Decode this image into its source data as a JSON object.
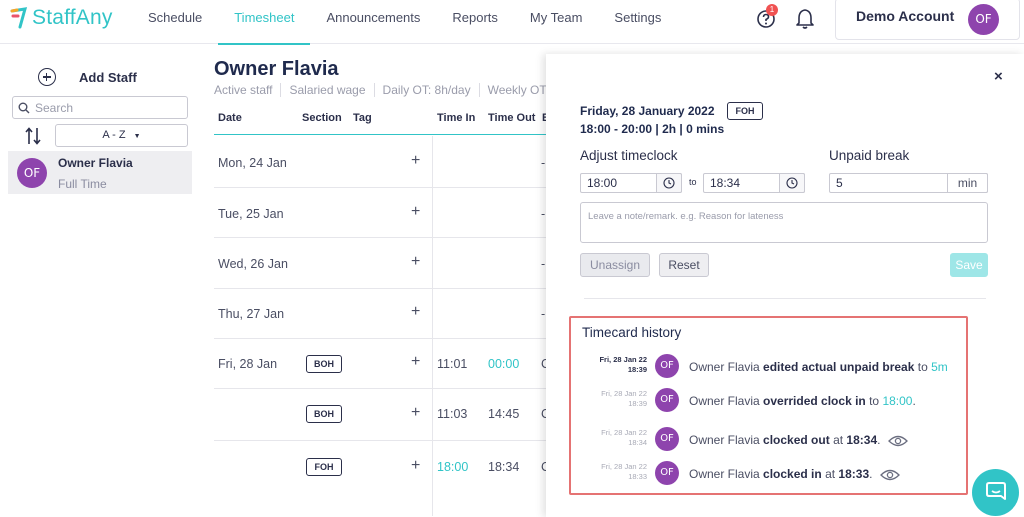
{
  "app": {
    "brand": "StaffAny",
    "accent": "#31c4c7",
    "avatar_color": "#8e44ad",
    "alert_color": "#f05252"
  },
  "nav": {
    "items": [
      {
        "label": "Schedule"
      },
      {
        "label": "Timesheet"
      },
      {
        "label": "Announcements"
      },
      {
        "label": "Reports"
      },
      {
        "label": "My Team"
      },
      {
        "label": "Settings"
      }
    ],
    "active": "Timesheet",
    "help_badge": "1",
    "account_name": "Demo Account",
    "account_initials": "OF"
  },
  "sidebar": {
    "add_staff_label": "Add Staff",
    "search_placeholder": "Search",
    "sort_label": "A - Z",
    "staff": [
      {
        "initials": "OF",
        "name": "Owner Flavia",
        "type": "Full Time"
      }
    ]
  },
  "main": {
    "title": "Owner Flavia",
    "meta": [
      "Active staff",
      "Salaried wage",
      "Daily OT: 8h/day",
      "Weekly OT"
    ],
    "columns": [
      "Date",
      "Section",
      "Tag",
      "Time In",
      "Time Out",
      "E"
    ],
    "rows": [
      {
        "date": "Mon, 24 Jan",
        "section": "",
        "time_in": "",
        "time_out": "",
        "extra": "-"
      },
      {
        "date": "Tue, 25 Jan",
        "section": "",
        "time_in": "",
        "time_out": "",
        "extra": "-"
      },
      {
        "date": "Wed, 26 Jan",
        "section": "",
        "time_in": "",
        "time_out": "",
        "extra": "-"
      },
      {
        "date": "Thu, 27 Jan",
        "section": "",
        "time_in": "",
        "time_out": "",
        "extra": "-"
      },
      {
        "date": "Fri, 28 Jan",
        "section": "BOH",
        "time_in": "11:01",
        "time_out": "00:00",
        "extra": "C"
      },
      {
        "date": "",
        "section": "BOH",
        "time_in": "11:03",
        "time_out": "14:45",
        "extra": "C"
      },
      {
        "date": "",
        "section": "FOH",
        "time_in": "18:00",
        "time_out": "18:34",
        "extra": "C"
      }
    ]
  },
  "panel": {
    "close_label": "×",
    "shift_date": "Friday, 28 January 2022",
    "shift_tag": "FOH",
    "shift_time": "18:00 - 20:00 | 2h | 0 mins",
    "adjust_label": "Adjust timeclock",
    "clock_in": "18:00",
    "to_label": "to",
    "clock_out": "18:34",
    "unpaid_label": "Unpaid break",
    "unpaid_value": "5",
    "unpaid_suffix": "min",
    "note_placeholder": "Leave a note/remark. e.g. Reason for lateness",
    "unassign_label": "Unassign",
    "reset_label": "Reset",
    "save_label": "Save",
    "history_title": "Timecard history",
    "history": [
      {
        "date": "Fri, 28 Jan 22",
        "time": "18:39",
        "initials": "OF",
        "actor": "Owner Flavia",
        "action": "edited actual unpaid break",
        "connector": "to",
        "value": "5m",
        "value_teal": true,
        "suffix": "",
        "eye": false,
        "dark": true
      },
      {
        "date": "Fri, 28 Jan 22",
        "time": "18:39",
        "initials": "OF",
        "actor": "Owner Flavia",
        "action": "overrided clock in",
        "connector": "to",
        "value": "18:00",
        "value_teal": true,
        "suffix": ".",
        "eye": false,
        "dark": false
      },
      {
        "date": "Fri, 28 Jan 22",
        "time": "18:34",
        "initials": "OF",
        "actor": "Owner Flavia",
        "action": "clocked out",
        "connector": "at",
        "value": "18:34",
        "value_teal": false,
        "suffix": ".",
        "eye": true,
        "dark": false
      },
      {
        "date": "Fri, 28 Jan 22",
        "time": "18:33",
        "initials": "OF",
        "actor": "Owner Flavia",
        "action": "clocked in",
        "connector": "at",
        "value": "18:33",
        "value_teal": false,
        "suffix": ".",
        "eye": true,
        "dark": false
      }
    ]
  }
}
